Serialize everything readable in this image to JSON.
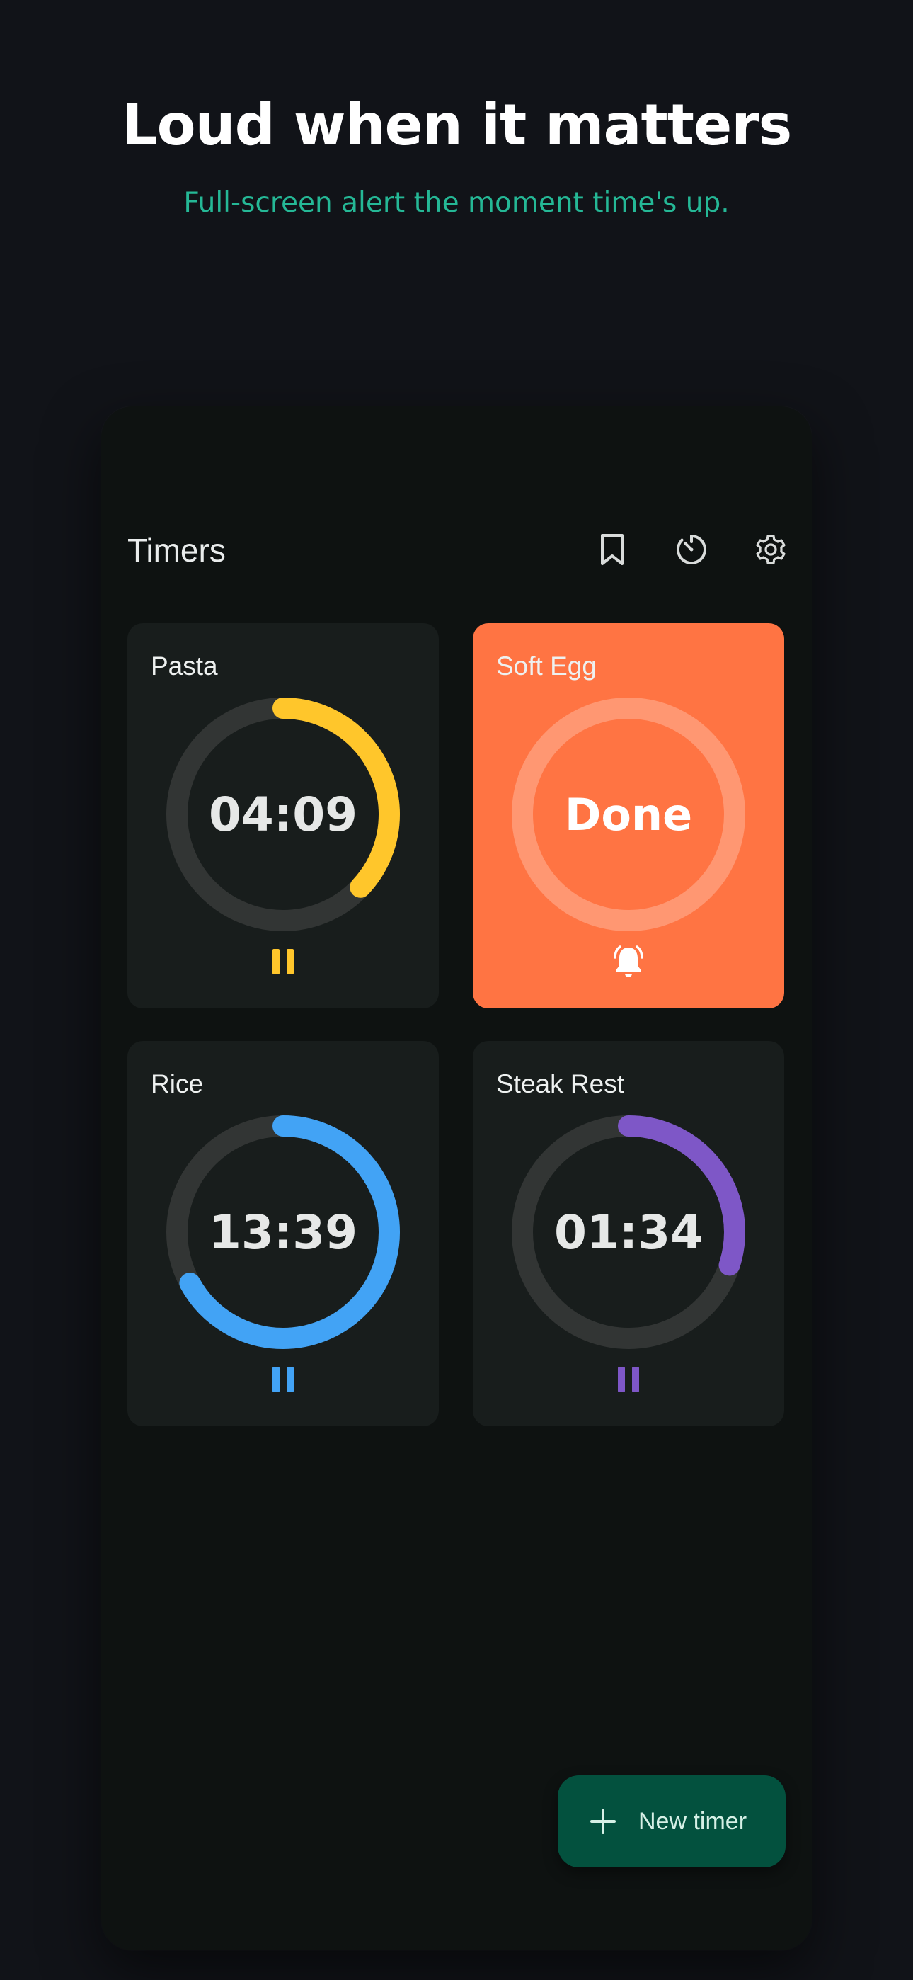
{
  "hero": {
    "title": "Loud when it matters",
    "subtitle": "Full-screen alert the moment time's up."
  },
  "app": {
    "title": "Timers",
    "toolbar_icons": [
      "bookmark-icon",
      "timer-dial-icon",
      "gear-icon"
    ]
  },
  "timers": [
    {
      "name": "Pasta",
      "display": "04:09",
      "state": "running",
      "progress": 0.37,
      "color": "#ffc62b",
      "action_icon": "pause-icon"
    },
    {
      "name": "Soft Egg",
      "display": "Done",
      "state": "done",
      "progress": 1.0,
      "color": "#ff7443",
      "action_icon": "bell-ringing-icon"
    },
    {
      "name": "Rice",
      "display": "13:39",
      "state": "running",
      "progress": 0.67,
      "color": "#42a3f5",
      "action_icon": "pause-icon"
    },
    {
      "name": "Steak Rest",
      "display": "01:34",
      "state": "running",
      "progress": 0.3,
      "color": "#7e57c7",
      "action_icon": "pause-icon"
    }
  ],
  "fab": {
    "label": "New timer",
    "icon": "plus-icon"
  },
  "colors": {
    "background": "#111318",
    "accent": "#25b896",
    "card": "#181d1c",
    "ring_track": "#323534",
    "fab": "#03513e"
  }
}
